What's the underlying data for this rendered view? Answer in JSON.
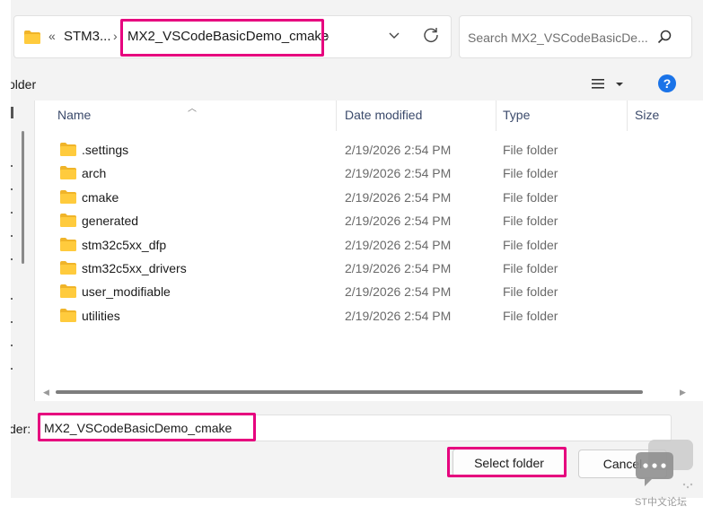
{
  "address_bar": {
    "crumbs": [
      "«",
      "STM3...",
      "›",
      "MX2_VSCodeBasicDemo_cmake",
      "›"
    ],
    "icons": [
      "folder-icon",
      "chevron-down-icon",
      "refresh-icon"
    ]
  },
  "search": {
    "placeholder": "Search MX2_VSCodeBasicDe...",
    "icon": "search-icon"
  },
  "toolbar": {
    "new_folder_label": "older",
    "view_icon": "list-view-icon",
    "help_icon": "help-icon",
    "help_glyph": "?"
  },
  "columns": {
    "name": "Name",
    "date": "Date modified",
    "type": "Type",
    "size": "Size"
  },
  "rows": [
    {
      "name": ".settings",
      "date": "2/19/2026 2:54 PM",
      "type": "File folder"
    },
    {
      "name": "arch",
      "date": "2/19/2026 2:54 PM",
      "type": "File folder"
    },
    {
      "name": "cmake",
      "date": "2/19/2026 2:54 PM",
      "type": "File folder"
    },
    {
      "name": "generated",
      "date": "2/19/2026 2:54 PM",
      "type": "File folder"
    },
    {
      "name": "stm32c5xx_dfp",
      "date": "2/19/2026 2:54 PM",
      "type": "File folder"
    },
    {
      "name": "stm32c5xx_drivers",
      "date": "2/19/2026 2:54 PM",
      "type": "File folder"
    },
    {
      "name": "user_modifiable",
      "date": "2/19/2026 2:54 PM",
      "type": "File folder"
    },
    {
      "name": "utilities",
      "date": "2/19/2026 2:54 PM",
      "type": "File folder"
    }
  ],
  "folder_field": {
    "label": "der:",
    "value": "MX2_VSCodeBasicDemo_cmake"
  },
  "buttons": {
    "select": "Select folder",
    "cancel": "Cancel"
  },
  "highlight_color": "#e6007e",
  "watermark": {
    "text": "ST中文论坛"
  }
}
